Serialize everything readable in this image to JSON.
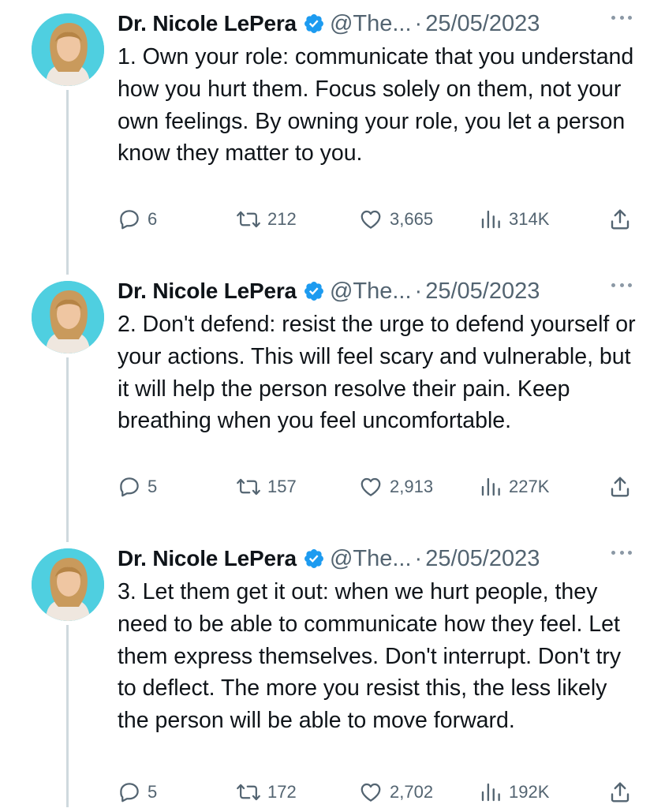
{
  "tweets": [
    {
      "author": "Dr. Nicole LePera",
      "handle": "@The...",
      "separator": "·",
      "date": "25/05/2023",
      "text": "1. Own your role: communicate that you understand how you hurt them. Focus solely on them, not your own feelings. By owning your role, you let a person know they matter to you.",
      "replies": "6",
      "retweets": "212",
      "likes": "3,665",
      "views": "314K"
    },
    {
      "author": "Dr. Nicole LePera",
      "handle": "@The...",
      "separator": "·",
      "date": "25/05/2023",
      "text": "2. Don't defend: resist the urge to defend yourself or your actions. This will feel scary and vulnerable, but it will help the person resolve their pain. Keep breathing when you feel uncomfortable.",
      "replies": "5",
      "retweets": "157",
      "likes": "2,913",
      "views": "227K"
    },
    {
      "author": "Dr. Nicole LePera",
      "handle": "@The...",
      "separator": "·",
      "date": "25/05/2023",
      "text": "3. Let them get it out: when we hurt people, they need to be able to communicate how they feel. Let them express themselves. Don't interrupt. Don't try to deflect. The more you resist this, the less likely the person will be able to move forward.",
      "replies": "5",
      "retweets": "172",
      "likes": "2,702",
      "views": "192K"
    }
  ],
  "colors": {
    "verified": "#1d9bf0",
    "secondary_text": "#536471",
    "thread_line": "#cfd9de",
    "avatar_bg": "#4fcfe0"
  },
  "icons": [
    "verified-badge-icon",
    "more-icon",
    "reply-icon",
    "retweet-icon",
    "like-icon",
    "views-icon",
    "share-icon"
  ]
}
